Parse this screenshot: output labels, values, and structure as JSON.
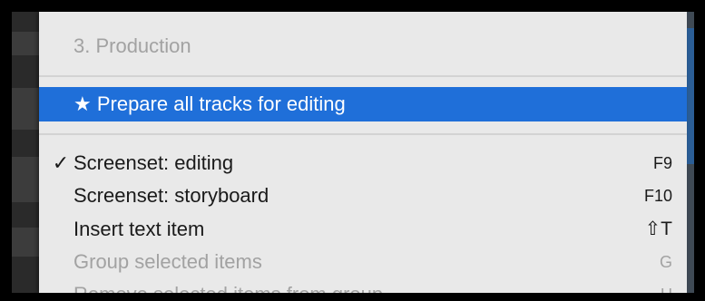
{
  "menu": {
    "section_title": "3. Production",
    "highlighted_item": {
      "label": "★ Prepare all tracks for editing"
    },
    "items": [
      {
        "check": "✓",
        "label": "Screenset: editing",
        "shortcut": "F9",
        "enabled": true
      },
      {
        "check": "",
        "label": "Screenset: storyboard",
        "shortcut": "F10",
        "enabled": true
      },
      {
        "check": "",
        "label": "Insert text item",
        "shortcut": "⇧T",
        "enabled": true
      },
      {
        "check": "",
        "label": "Group selected items",
        "shortcut": "G",
        "enabled": false
      },
      {
        "check": "",
        "label": "Remove selected items from group",
        "shortcut": "U",
        "enabled": false
      }
    ]
  },
  "colors": {
    "menu_background": "#e9e9e9",
    "highlight": "#1f6fd9",
    "disabled_text": "#a2a2a2",
    "text": "#1a1a1a"
  }
}
